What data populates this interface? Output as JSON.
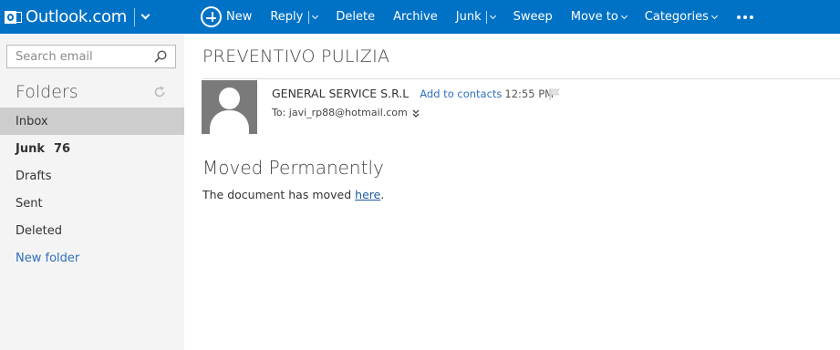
{
  "app": {
    "brand": "Outlook.com"
  },
  "toolbar": {
    "new_label": "New",
    "reply_label": "Reply",
    "delete_label": "Delete",
    "archive_label": "Archive",
    "junk_label": "Junk",
    "sweep_label": "Sweep",
    "move_to_label": "Move to",
    "categories_label": "Categories"
  },
  "sidebar": {
    "search_placeholder": "Search email",
    "folders_heading": "Folders",
    "folders": [
      {
        "label": "Inbox",
        "count": ""
      },
      {
        "label": "Junk",
        "count": "76"
      },
      {
        "label": "Drafts",
        "count": ""
      },
      {
        "label": "Sent",
        "count": ""
      },
      {
        "label": "Deleted",
        "count": ""
      }
    ],
    "new_folder_label": "New folder"
  },
  "message": {
    "subject": "PREVENTIVO PULIZIA",
    "sender": "GENERAL SERVICE S.R.L",
    "add_to_contacts": "Add to contacts",
    "time": "12:55 PM",
    "to_prefix": "To:",
    "to_address": "javi_rp88@hotmail.com",
    "body_title": "Moved Permanently",
    "body_text_before": "The document has moved ",
    "body_link": "here",
    "body_text_after": "."
  },
  "colors": {
    "topbar": "#0072c6",
    "sidebar": "#f4f4f4",
    "active_folder": "#cdcdcd",
    "link": "#2f6fba"
  },
  "icons": [
    "outlook-logo-icon",
    "chevron-down-icon",
    "plus-circle-icon",
    "search-icon",
    "refresh-icon",
    "flag-icon",
    "expand-icon",
    "more-dots-icon",
    "avatar-placeholder-icon"
  ]
}
